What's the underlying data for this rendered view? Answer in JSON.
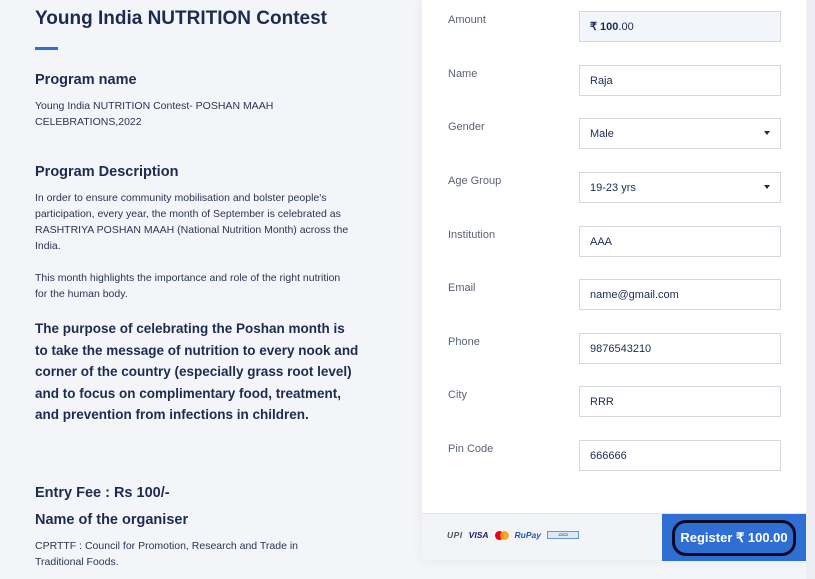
{
  "left": {
    "title": "Young India NUTRITION Contest",
    "program_name_heading": "Program name",
    "program_name_text": "Young India NUTRITION Contest- POSHAN MAAH CELEBRATIONS,2022",
    "program_desc_heading": "Program Description",
    "desc_para1": "In order to ensure community mobilisation and bolster people's participation, every year, the month of September is celebrated as RASHTRIYA POSHAN MAAH (National Nutrition Month) across the India.",
    "desc_para2": "This month highlights the importance and role of the right nutrition for the human body.",
    "purpose_text": "The purpose of celebrating the Poshan month is to take the message of nutrition to every nook and corner of the country (especially grass root level) and to focus on complimentary food, treatment, and prevention from infections in children.",
    "entry_fee": "Entry Fee : Rs 100/-",
    "organiser_heading": "Name of the organiser",
    "organiser_text": "CPRTTF : Council for Promotion, Research and Trade in Traditional Foods."
  },
  "form": {
    "amount_label": "Amount",
    "amount_bold": "₹ 100",
    "amount_decimals": ".00",
    "name_label": "Name",
    "name_value": "Raja",
    "gender_label": "Gender",
    "gender_value": "Male",
    "age_label": "Age Group",
    "age_value": "19-23 yrs",
    "institution_label": "Institution",
    "institution_value": "AAA",
    "email_label": "Email",
    "email_value": "name@gmail.com",
    "phone_label": "Phone",
    "phone_value": "9876543210",
    "city_label": "City",
    "city_value": "RRR",
    "pincode_label": "Pin Code",
    "pincode_value": "666666"
  },
  "footer": {
    "logos": {
      "upi": "UPI",
      "visa": "VISA",
      "mastercard": "mastercard-icon",
      "rupay": "RuPay",
      "netbanking": "netbanking-icon"
    },
    "register_label": "Register  ₹ 100.00"
  },
  "colors": {
    "accent": "#2f6fd3",
    "text_dark": "#1d2b4f",
    "background": "#f4f5f9"
  }
}
